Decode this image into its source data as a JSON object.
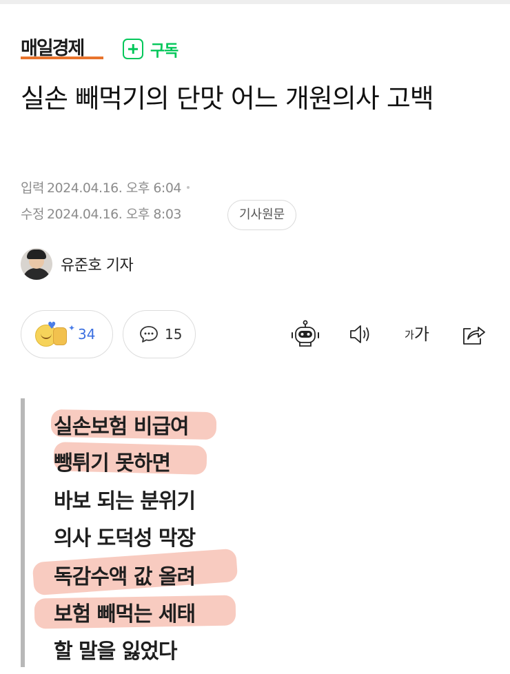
{
  "press": {
    "logo": "매일경제",
    "subscribe_label": "구독",
    "accent": "#e8742d",
    "subscribe_color": "#03c75a"
  },
  "article": {
    "title": "실손 빼먹기의 단맛 어느 개원의사 고백",
    "input_label": "입력",
    "input_date": "2024.04.16. 오후 6:04",
    "modified_label": "수정",
    "modified_date": "2024.04.16. 오후 8:03",
    "original_button": "기사원문",
    "reporter": "유준호 기자"
  },
  "reactions": {
    "like_count": "34",
    "comment_count": "15",
    "like_color": "#3b6fe0"
  },
  "tools": {
    "font_small": "가",
    "font_large": "가",
    "icons": [
      "robot-icon",
      "speaker-icon",
      "font-size-icon",
      "share-icon"
    ]
  },
  "quote": {
    "lines": [
      "실손보험 비급여",
      "뺑튀기 못하면",
      "바보 되는 분위기",
      "의사 도덕성 막장",
      "독감수액 값 올려",
      "보험 빼먹는 세태",
      "할 말을 잃었다"
    ],
    "highlight_color": "#f3a08c"
  }
}
